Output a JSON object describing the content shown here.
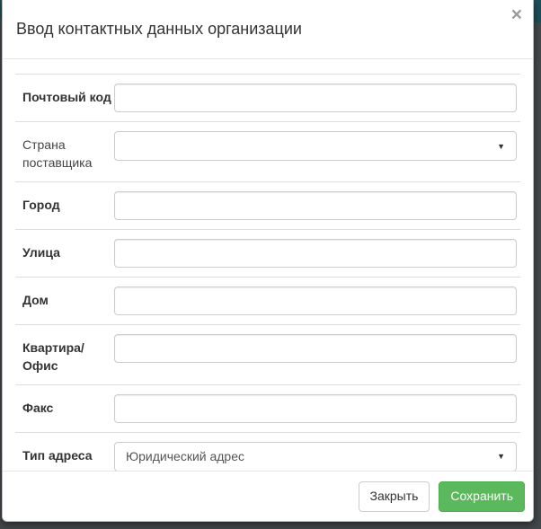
{
  "modal": {
    "title": "Ввод контактных данных организации",
    "close_icon": "×"
  },
  "icons": {
    "dropdown_arrow": "▼"
  },
  "fields": [
    {
      "id": "postal-code",
      "label": "Почтовый код",
      "type": "text",
      "value": "",
      "bold": true
    },
    {
      "id": "supplier-country",
      "label": "Страна поставщика",
      "type": "select",
      "value": "",
      "bold": false
    },
    {
      "id": "city",
      "label": "Город",
      "type": "text",
      "value": "",
      "bold": true
    },
    {
      "id": "street",
      "label": "Улица",
      "type": "text",
      "value": "",
      "bold": true
    },
    {
      "id": "house",
      "label": "Дом",
      "type": "text",
      "value": "",
      "bold": true
    },
    {
      "id": "apartment-office",
      "label": "Квартира/Офис",
      "type": "text",
      "value": "",
      "bold": true
    },
    {
      "id": "fax",
      "label": "Факс",
      "type": "text",
      "value": "",
      "bold": true
    },
    {
      "id": "address-type",
      "label": "Тип адреса",
      "type": "select",
      "value": "Юридический адрес",
      "bold": true
    }
  ],
  "footer": {
    "close_label": "Закрыть",
    "save_label": "Сохранить"
  },
  "colors": {
    "save_button_bg": "#5cb85c",
    "save_button_border": "#4cae4c",
    "backdrop": "#43484d",
    "page_accent_teal": "#1e4e57",
    "row_divider": "#dddddd",
    "header_divider": "#e5e5e5"
  }
}
